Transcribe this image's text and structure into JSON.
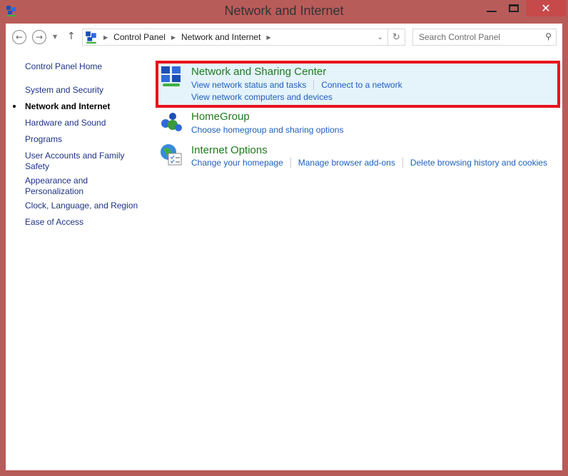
{
  "window": {
    "title": "Network and Internet",
    "close": "✕"
  },
  "address": {
    "crumbs": [
      "Control Panel",
      "Network and Internet"
    ]
  },
  "search": {
    "placeholder": "Search Control Panel"
  },
  "sidebar": {
    "items": [
      {
        "label": "Control Panel Home"
      },
      {
        "label": "System and Security"
      },
      {
        "label": "Network and Internet",
        "current": true
      },
      {
        "label": "Hardware and Sound"
      },
      {
        "label": "Programs"
      },
      {
        "label": "User Accounts and Family Safety"
      },
      {
        "label": "Appearance and Personalization"
      },
      {
        "label": "Clock, Language, and Region"
      },
      {
        "label": "Ease of Access"
      }
    ]
  },
  "categories": [
    {
      "title": "Network and Sharing Center",
      "links": [
        "View network status and tasks",
        "Connect to a network"
      ],
      "links2": [
        "View network computers and devices"
      ]
    },
    {
      "title": "HomeGroup",
      "links": [
        "Choose homegroup and sharing options"
      ]
    },
    {
      "title": "Internet Options",
      "links": [
        "Change your homepage",
        "Manage browser add-ons",
        "Delete browsing history and cookies"
      ]
    }
  ],
  "colors": {
    "frame": "#b85c5a",
    "highlight_border": "#e8141c",
    "link": "#1e5fbf",
    "heading": "#1e7a1e"
  }
}
